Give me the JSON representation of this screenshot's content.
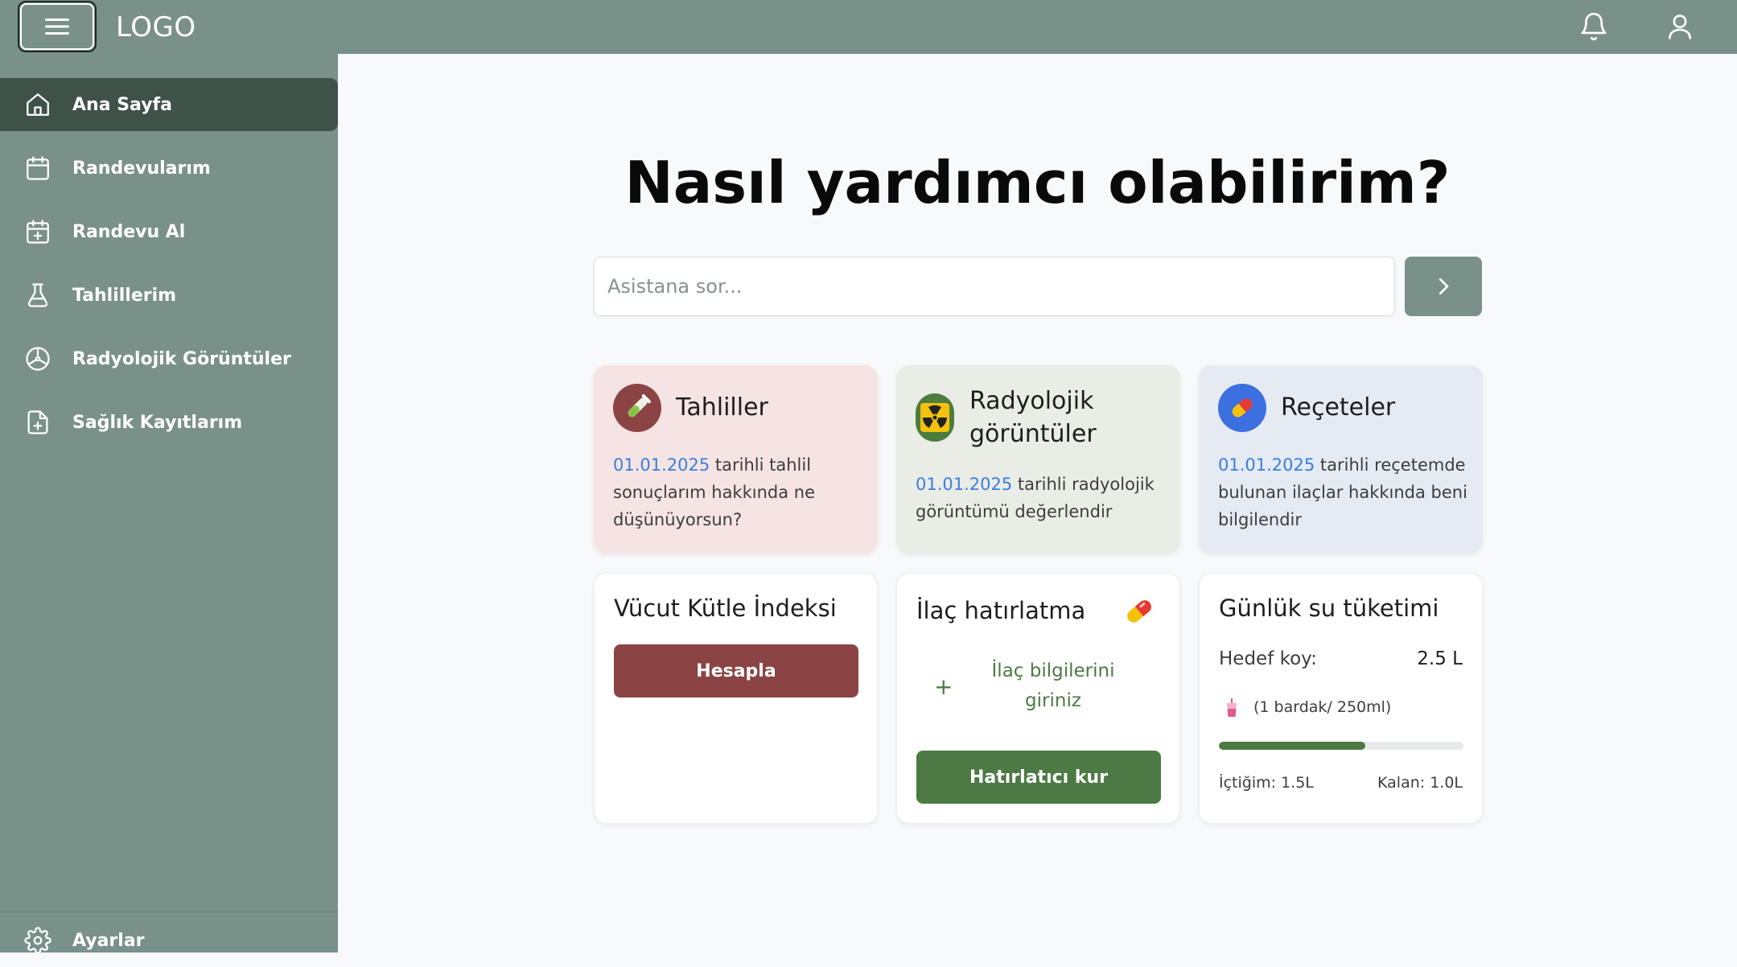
{
  "header": {
    "logo": "LOGO",
    "menu_icon": "hamburger-icon",
    "notification_icon": "bell-icon",
    "user_icon": "user-icon"
  },
  "sidebar": {
    "items": [
      {
        "label": "Ana Sayfa",
        "icon": "home-icon",
        "active": true
      },
      {
        "label": "Randevularım",
        "icon": "calendar-icon",
        "active": false
      },
      {
        "label": "Randevu Al",
        "icon": "calendar-plus-icon",
        "active": false
      },
      {
        "label": "Tahlillerim",
        "icon": "flask-icon",
        "active": false
      },
      {
        "label": "Radyolojik Görüntüler",
        "icon": "radiology-icon",
        "active": false
      },
      {
        "label": "Sağlık Kayıtlarım",
        "icon": "file-plus-icon",
        "active": false
      }
    ],
    "settings": {
      "label": "Ayarlar",
      "icon": "gear-icon"
    }
  },
  "main": {
    "heading": "Nasıl yardımcı olabilirim?",
    "search": {
      "placeholder": "Asistana sor...",
      "value": ""
    },
    "send_icon": "chevron-right-icon",
    "suggestion_cards": [
      {
        "title": "Tahliller",
        "icon": "test-tube-icon",
        "date": "01.01.2025",
        "text": " tarihli tahlil sonuçlarım hakkında ne düşünüyorsun?",
        "bg": "#f5e4e3",
        "icon_bg": "#8b4443"
      },
      {
        "title": "Radyolojik görüntüler",
        "icon": "radiation-icon",
        "date": "01.01.2025",
        "text": " tarihli radyolojik görüntümü değerlendir",
        "bg": "#eaece6",
        "icon_bg": "#4c7c3e"
      },
      {
        "title": "Reçeteler",
        "icon": "pill-icon",
        "date": "01.01.2025",
        "text": " tarihli reçetemde bulunan ilaçlar hakkında beni bilgilendir",
        "bg": "#e5eaf3",
        "icon_bg": "#3c6fe0"
      }
    ],
    "bmi": {
      "title": "Vücut Kütle İndeksi",
      "button": "Hesapla"
    },
    "medication": {
      "title": "İlaç hatırlatma",
      "icon": "pill-icon",
      "add_symbol": "+",
      "add_text": "İlaç bilgilerini giriniz",
      "button": "Hatırlatıcı kur"
    },
    "water": {
      "title": "Günlük su tüketimi",
      "target_label": "Hedef koy:",
      "target_value": "2.5 L",
      "cup_icon": "cup-icon",
      "cup_text": "(1 bardak/ 250ml)",
      "drank": "İçtiğim: 1.5L",
      "remaining": "Kalan: 1.0L",
      "progress": 0.6
    }
  },
  "colors": {
    "sidebar": "#7a918a",
    "active_item": "#3f5249",
    "bmi_button": "#8b4443",
    "reminder_button": "#4d7a44",
    "progress": "#4d7a44"
  }
}
